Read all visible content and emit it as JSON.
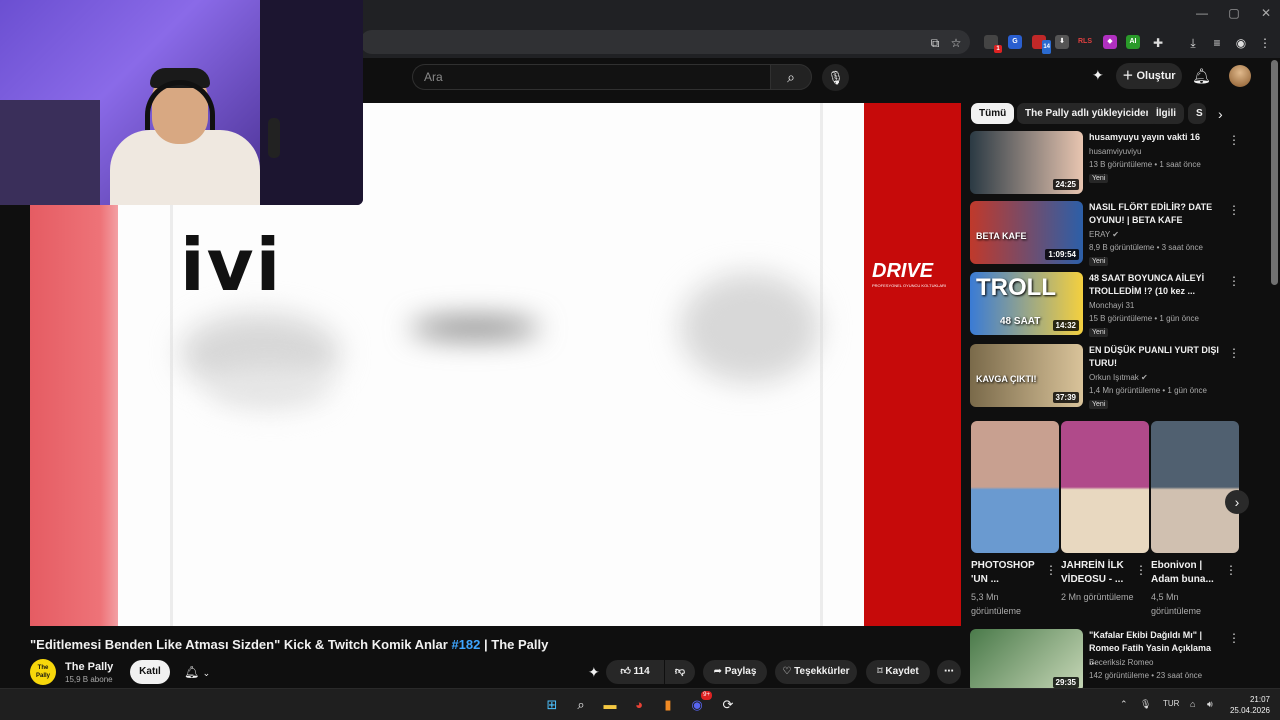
{
  "browser": {
    "window_controls": [
      "—",
      "▢",
      "✕"
    ],
    "extension_badges": [
      "1",
      "14",
      "RLS",
      "AI"
    ]
  },
  "header": {
    "search_placeholder": "Ara",
    "create_label": "Oluştur"
  },
  "player": {
    "brand_logo": "ivi",
    "sponsor_logo": "DRIVE",
    "sponsor_sub": "PROFESYONEL OYUNCU KOLTUKLARI"
  },
  "video": {
    "title_prefix": "\"Editlemesi Benden Like Atması Sizden\" Kick & Twitch Komik Anlar",
    "title_tag": "#182",
    "title_suffix": "| The Pally",
    "channel": "The Pally",
    "channel_avatar_text": "The Pally",
    "subscribers": "15,9 B abone",
    "join_label": "Katıl",
    "likes": "114",
    "share_label": "Paylaş",
    "thanks_label": "Teşekkürler",
    "save_label": "Kaydet"
  },
  "chips": [
    "Tümü",
    "The Pally adlı yükleyiciden",
    "İlgili",
    "S"
  ],
  "recommendations": [
    {
      "title": "husamyuyu yayın vakti 16",
      "channel": "husamviyuviyu",
      "meta": "13 B görüntüleme • 1 saat önce",
      "duration": "24:25",
      "badge": "Yeni",
      "colors": [
        "#2b3a44",
        "#e8c5b0"
      ]
    },
    {
      "title": "NASIL FLÖRT EDİLİR? DATE OYUNU! | BETA KAFE",
      "channel": "ERAY",
      "meta": "8,9 B görüntüleme • 3 saat önce",
      "duration": "1:09:54",
      "badge": "Yeni",
      "overlay": "BETA KAFE",
      "colors": [
        "#c0392b",
        "#2c5fa8"
      ]
    },
    {
      "title": "48 SAAT BOYUNCA AİLEYİ TROLLEDİM !? (10 kez ...",
      "channel": "Monchayi 31",
      "meta": "15 B görüntüleme • 1 gün önce",
      "duration": "14:32",
      "badge": "Yeni",
      "overlay": "TROLL",
      "overlay2": "48 SAAT",
      "colors": [
        "#3a7bd5",
        "#f4d03f"
      ]
    },
    {
      "title": "EN DÜŞÜK PUANLI YURT DIŞI TURU!",
      "channel": "Orkun Işıtmak",
      "meta": "1,4 Mn görüntüleme • 1 gün önce",
      "duration": "37:39",
      "badge": "Yeni",
      "overlay": "KAVGA ÇIKTI!",
      "colors": [
        "#7a6a4a",
        "#d9c39a"
      ]
    }
  ],
  "shorts": [
    {
      "title": "PHOTOSHOP 'UN ...",
      "views": "5,3 Mn görüntüleme",
      "colors": [
        "#c8a090",
        "#6a9ad0"
      ]
    },
    {
      "title": "JAHREİN İLK VİDEOSU - ...",
      "views": "2 Mn görüntüleme",
      "colors": [
        "#b04a8a",
        "#e8d8c0"
      ]
    },
    {
      "title": "Ebonivon | Adam buna...",
      "views": "4,5 Mn görüntüleme",
      "colors": [
        "#506070",
        "#d0c0b0"
      ]
    }
  ],
  "rec_bottom": {
    "title": "\"Kafalar Ekibi Dağıldı Mı\" | Romeo Fatih Yasin Açıklama ...",
    "channel": "Beceriksiz Romeo",
    "meta": "142 görüntüleme • 23 saat önce",
    "duration": "29:35",
    "colors": [
      "#4a7a4a",
      "#c8d8b8"
    ]
  },
  "taskbar": {
    "lang": "TUR",
    "time": "21:07",
    "date": "25.04.2026",
    "discord_badge": "9+"
  }
}
